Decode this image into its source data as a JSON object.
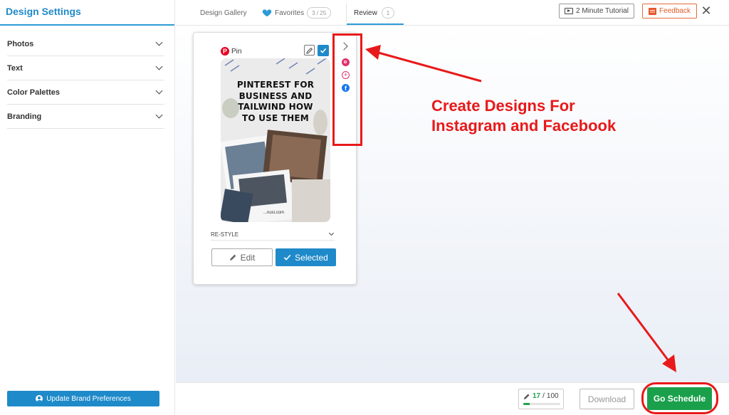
{
  "sidebar": {
    "title": "Design Settings",
    "items": [
      {
        "label": "Photos"
      },
      {
        "label": "Text"
      },
      {
        "label": "Color Palettes"
      },
      {
        "label": "Branding"
      }
    ],
    "update_button": "Update Brand Preferences"
  },
  "header": {
    "tabs": {
      "gallery": "Design Gallery",
      "favorites": "Favorites",
      "favorites_count": "3 / 25",
      "review": "Review",
      "review_count": "1"
    },
    "tutorial_button": "2 Minute Tutorial",
    "feedback_button": "Feedback",
    "close_glyph": "✕"
  },
  "card": {
    "pin_label": "Pin",
    "pin_headline": "PINTEREST FOR BUSINESS AND TAILWIND HOW TO USE THEM",
    "pin_url": "...nusi.com",
    "restyle_label": "RE-STYLE",
    "edit_button": "Edit",
    "selected_button": "Selected",
    "icons": [
      "pinterest-icon",
      "pencil-icon",
      "checkmark-icon",
      "chevron-right-icon",
      "instagram-icon",
      "plus-circle-icon",
      "facebook-icon"
    ]
  },
  "annotation": {
    "line1": "Create Designs For",
    "line2": "Instagram and Facebook"
  },
  "footer": {
    "progress_count": "17",
    "progress_sep": "/",
    "progress_total": "100",
    "progress_fraction": 0.17,
    "download_button": "Download",
    "go_schedule_button": "Go Schedule"
  },
  "colors": {
    "accent_blue": "#1f8ac9",
    "go_green": "#1aa04b",
    "annotation_red": "#e8191a",
    "feedback_orange": "#e05a24"
  }
}
